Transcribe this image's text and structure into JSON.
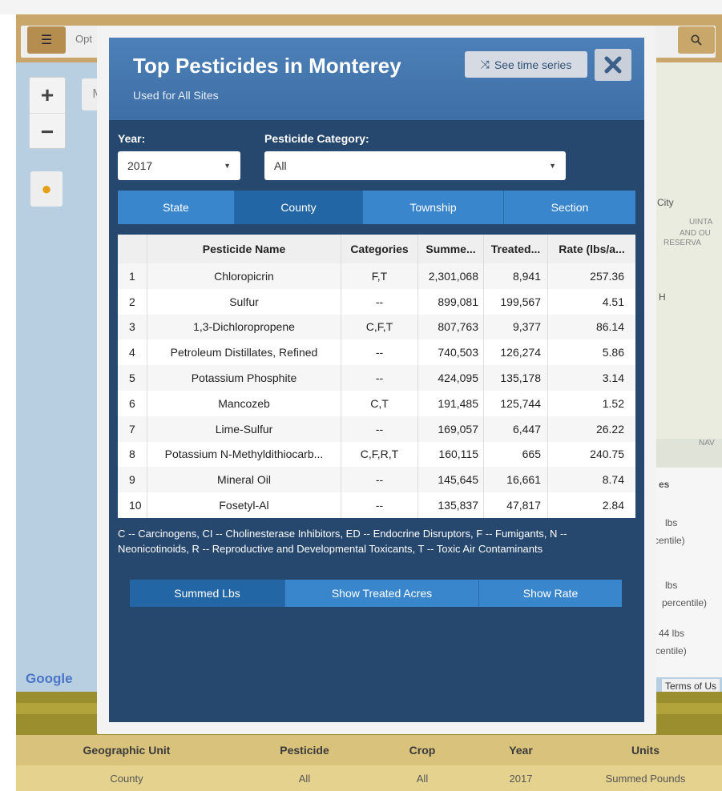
{
  "modal": {
    "title": "Top Pesticides in Monterey",
    "subtitle": "Used for All Sites",
    "time_series_label": "See time series",
    "year_label": "Year:",
    "year_value": "2017",
    "category_label": "Pesticide Category:",
    "category_value": "All",
    "level_tabs": [
      "State",
      "County",
      "Township",
      "Section"
    ],
    "active_level_tab": "County",
    "table": {
      "headers": [
        "",
        "Pesticide Name",
        "Categories",
        "Summe...",
        "Treated...",
        "Rate (lbs/a..."
      ],
      "rows": [
        [
          "1",
          "Chloropicrin",
          "F,T",
          "2,301,068",
          "8,941",
          "257.36"
        ],
        [
          "2",
          "Sulfur",
          "--",
          "899,081",
          "199,567",
          "4.51"
        ],
        [
          "3",
          "1,3-Dichloropropene",
          "C,F,T",
          "807,763",
          "9,377",
          "86.14"
        ],
        [
          "4",
          "Petroleum Distillates, Refined",
          "--",
          "740,503",
          "126,274",
          "5.86"
        ],
        [
          "5",
          "Potassium Phosphite",
          "--",
          "424,095",
          "135,178",
          "3.14"
        ],
        [
          "6",
          "Mancozeb",
          "C,T",
          "191,485",
          "125,744",
          "1.52"
        ],
        [
          "7",
          "Lime-Sulfur",
          "--",
          "169,057",
          "6,447",
          "26.22"
        ],
        [
          "8",
          "Potassium N-Methyldithiocarb...",
          "C,F,R,T",
          "160,115",
          "665",
          "240.75"
        ],
        [
          "9",
          "Mineral Oil",
          "--",
          "145,645",
          "16,661",
          "8.74"
        ],
        [
          "10",
          "Fosetyl-Al",
          "--",
          "135,837",
          "47,817",
          "2.84"
        ]
      ]
    },
    "legend_note": "C -- Carcinogens, CI -- Cholinesterase Inhibitors, ED -- Endocrine Disruptors, F -- Fumigants, N -- Neonicotinoids, R -- Reproductive and Developmental Toxicants, T -- Toxic Air Contaminants",
    "metric_tabs": [
      "Summed Lbs",
      "Show Treated Acres",
      "Show Rate"
    ],
    "active_metric_tab": "Summed Lbs"
  },
  "background": {
    "options_label": "Opt",
    "m_button": "M",
    "google": "Google",
    "terms": "Terms of Us",
    "side_labels": [
      "City",
      "UINTA",
      "AND OU",
      "RESERVA",
      "H",
      "NAV",
      "es",
      "lbs",
      "rcentile)",
      "lbs",
      "percentile)",
      "44 lbs",
      "centile)"
    ],
    "summary_headers": [
      "Geographic Unit",
      "Pesticide",
      "Crop",
      "Year",
      "Units"
    ],
    "summary_values": [
      "County",
      "All",
      "All",
      "2017",
      "Summed Pounds"
    ]
  },
  "colors": {
    "modal_bg": "#26476e",
    "tab_blue": "#3a86cc",
    "tab_active": "#2366a6",
    "olive": "#9b8e2e",
    "tan": "#d9c27c"
  }
}
